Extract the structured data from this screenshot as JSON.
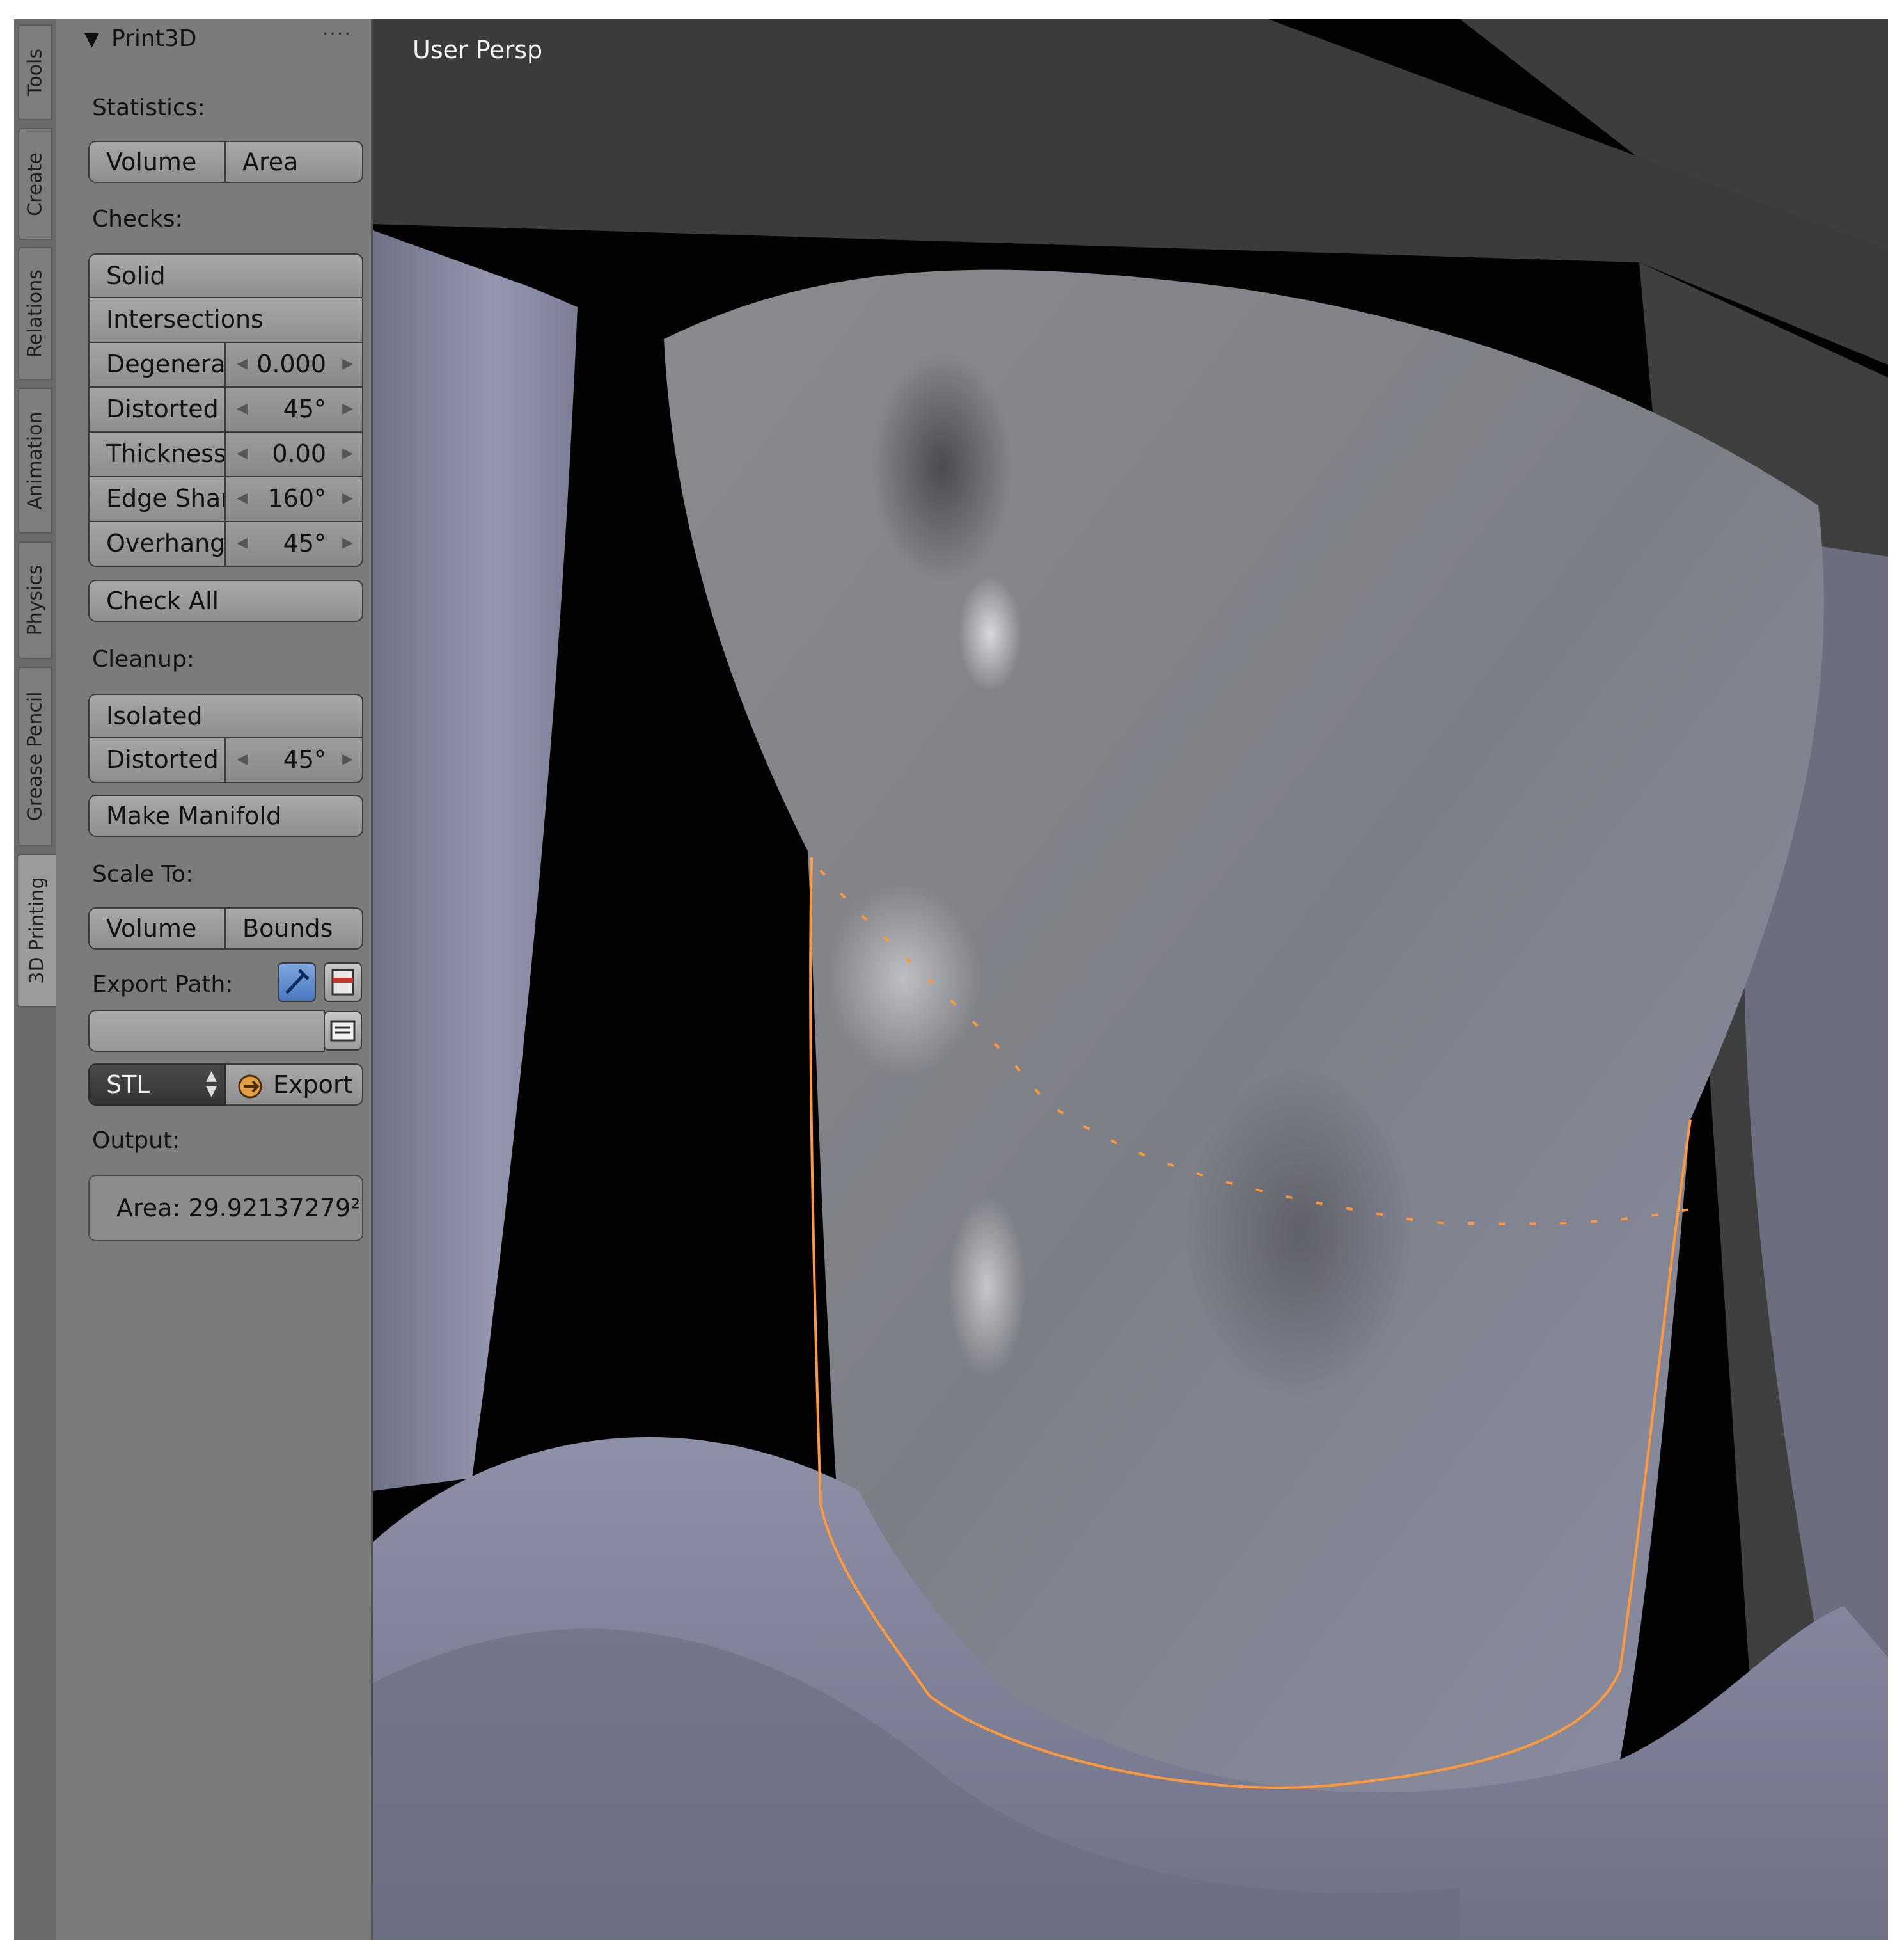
{
  "tabs": [
    {
      "label": "Tools",
      "active": false
    },
    {
      "label": "Create",
      "active": false
    },
    {
      "label": "Relations",
      "active": false
    },
    {
      "label": "Animation",
      "active": false
    },
    {
      "label": "Physics",
      "active": false
    },
    {
      "label": "Grease Pencil",
      "active": false
    },
    {
      "label": "3D Printing",
      "active": true
    }
  ],
  "panel": {
    "title": "Print3D",
    "statistics": {
      "label": "Statistics:",
      "volume_button": "Volume",
      "area_button": "Area"
    },
    "checks": {
      "label": "Checks:",
      "solid_button": "Solid",
      "intersections_button": "Intersections",
      "rows": [
        {
          "name": "Degenerat",
          "value": "0.000"
        },
        {
          "name": "Distorted",
          "value": "45°"
        },
        {
          "name": "Thickness",
          "value": "0.00"
        },
        {
          "name": "Edge Shar",
          "value": "160°"
        },
        {
          "name": "Overhang",
          "value": "45°"
        }
      ],
      "check_all_button": "Check All"
    },
    "cleanup": {
      "label": "Cleanup:",
      "isolated_button": "Isolated",
      "distorted": {
        "name": "Distorted",
        "value": "45°"
      },
      "make_manifold_button": "Make Manifold"
    },
    "scale_to": {
      "label": "Scale To:",
      "volume_button": "Volume",
      "bounds_button": "Bounds"
    },
    "export": {
      "path_label": "Export Path:",
      "path_value": "",
      "format": "STL",
      "export_button": "Export"
    },
    "output": {
      "label": "Output:",
      "value": "Area: 29.92137279²"
    }
  },
  "viewport": {
    "label": "User Persp"
  },
  "colors": {
    "panel_bg": "#7b7b7b",
    "button": "#9c9c9c",
    "viewport_bg": "#3d3d3d",
    "mesh_gray": "#8a8c90",
    "mesh_blue": "#8c8fa8",
    "highlight": "#ff9a3c"
  }
}
